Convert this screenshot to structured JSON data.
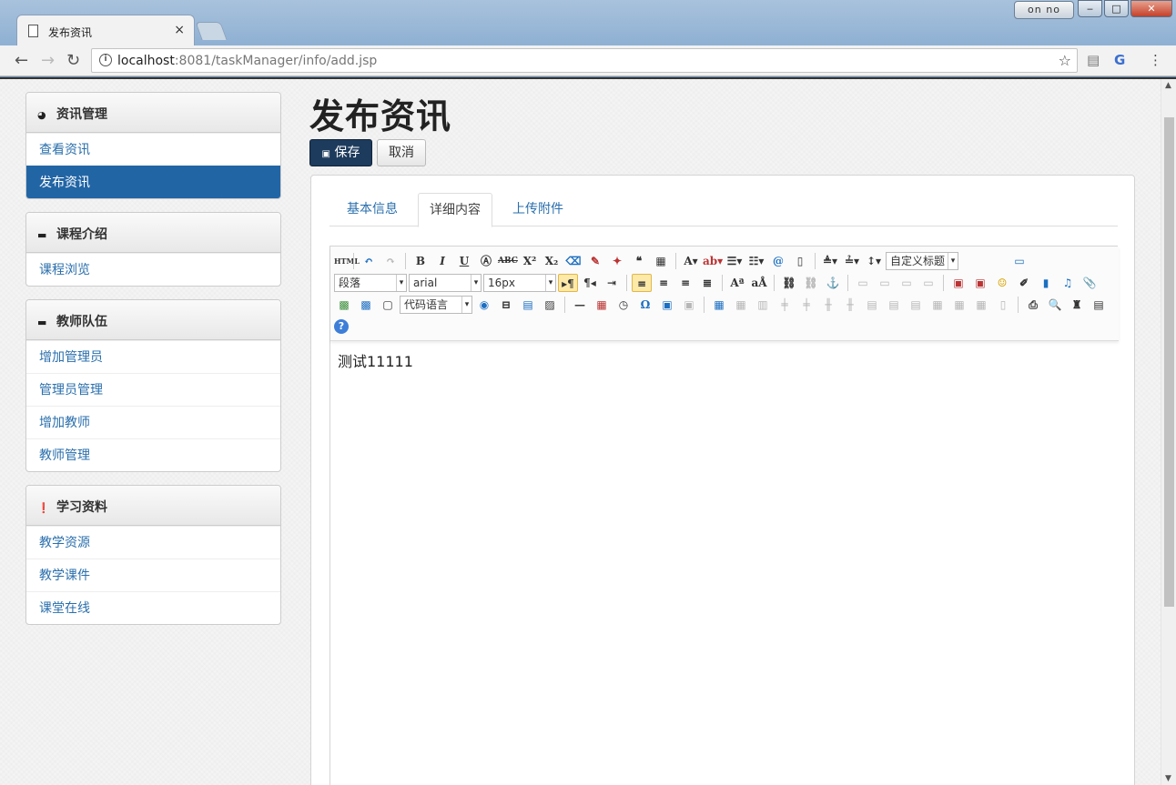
{
  "browser": {
    "tab_title": "发布资讯",
    "tab_close": "×",
    "profile_label": "on no",
    "url_host": "localhost",
    "url_rest": ":8081/taskManager/info/add.jsp",
    "win_min": "‒",
    "win_max": "□",
    "win_close": "✕"
  },
  "sidebar": [
    {
      "title": "资讯管理",
      "icon": "dashboard-icon",
      "glyph": "◕",
      "items": [
        "查看资讯",
        "发布资讯"
      ],
      "active": 1
    },
    {
      "title": "课程介绍",
      "icon": "briefcase-icon",
      "glyph": "▬",
      "items": [
        "课程浏览"
      ]
    },
    {
      "title": "教师队伍",
      "icon": "briefcase-icon",
      "glyph": "▬",
      "items": [
        "增加管理员",
        "管理员管理",
        "增加教师",
        "教师管理"
      ]
    },
    {
      "title": "学习资料",
      "icon": "exclamation-icon",
      "glyph": "❗",
      "items": [
        "教学资源",
        "教学课件",
        "课堂在线"
      ]
    }
  ],
  "main": {
    "title": "发布资讯",
    "save_label": "保存",
    "cancel_label": "取消",
    "tabs": [
      "基本信息",
      "详细内容",
      "上传附件"
    ],
    "active_tab": 1
  },
  "editor": {
    "paragraph": "段落",
    "font_family": "arial",
    "font_size": "16px",
    "custom_title": "自定义标题",
    "code_lang": "代码语言",
    "content": "测试11111",
    "html_btn": "HTML"
  }
}
